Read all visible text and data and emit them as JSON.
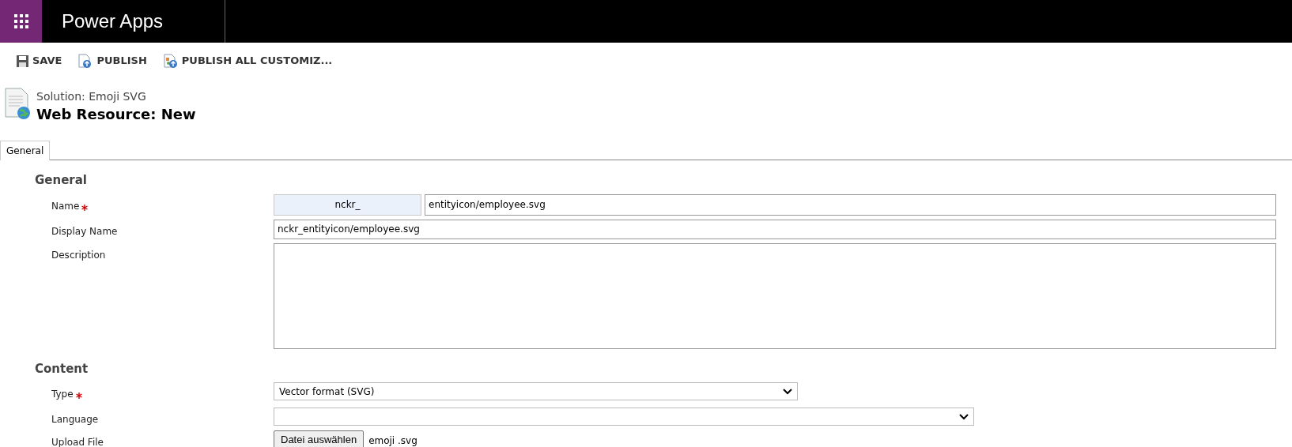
{
  "app": {
    "title": "Power Apps"
  },
  "toolbar": [
    {
      "label": "SAVE"
    },
    {
      "label": "PUBLISH"
    },
    {
      "label": "PUBLISH ALL CUSTOMIZ..."
    }
  ],
  "header": {
    "subtitle": "Solution: Emoji SVG",
    "title": "Web Resource: New"
  },
  "tabs": [
    {
      "label": "General",
      "selected": true
    }
  ],
  "sections": [
    {
      "title": "General",
      "fields": [
        {
          "kind": "prefixed",
          "label": "Name",
          "required": true,
          "prefix": "nckr_",
          "value": "entityicon/employee.svg"
        },
        {
          "kind": "text",
          "label": "Display Name",
          "required": false,
          "value": "nckr_entityicon/employee.svg"
        },
        {
          "kind": "textarea",
          "label": "Description",
          "required": false
        }
      ]
    },
    {
      "title": "Content",
      "fields": [
        {
          "kind": "select",
          "label": "Type",
          "required": true,
          "value": "Vector format (SVG)"
        },
        {
          "kind": "select",
          "label": "Language",
          "required": false
        },
        {
          "kind": "file",
          "label": "Upload File",
          "required": false,
          "button": "Datei auswählen",
          "value": "emoji .svg"
        }
      ]
    }
  ]
}
